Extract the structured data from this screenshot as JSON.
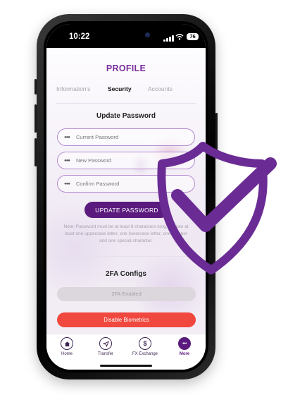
{
  "status_bar": {
    "time": "10:22",
    "battery": "76"
  },
  "header": {
    "title": "PROFILE"
  },
  "tabs": [
    {
      "label": "Information's",
      "active": false
    },
    {
      "label": "Security",
      "active": true
    },
    {
      "label": "Accounts",
      "active": false
    }
  ],
  "update_password": {
    "title": "Update Password",
    "fields": [
      {
        "placeholder": "Current Password",
        "value": ""
      },
      {
        "placeholder": "New Password",
        "value": ""
      },
      {
        "placeholder": "Confirm Password",
        "value": ""
      }
    ],
    "button_label": "UPDATE PASSWORD",
    "note": "Note: Password must be at least 8 characters long, contain at least one uppercase letter, one lowercase letter, one number and one special character."
  },
  "twofa": {
    "title": "2FA Configs",
    "status_label": "2FA Enabled"
  },
  "biometrics": {
    "button_label": "Disable Biometrics"
  },
  "bottom_nav": [
    {
      "label": "Home",
      "icon": "home-icon",
      "active": false
    },
    {
      "label": "Transfer",
      "icon": "send-icon",
      "active": false
    },
    {
      "label": "FX Exchange",
      "icon": "dollar-icon",
      "active": false
    },
    {
      "label": "More",
      "icon": "more-icon",
      "active": true
    }
  ],
  "colors": {
    "accent": "#7b2f9e",
    "primary_button": "#5a1a7e",
    "danger": "#f0473e",
    "shield": "#6a2c94"
  }
}
